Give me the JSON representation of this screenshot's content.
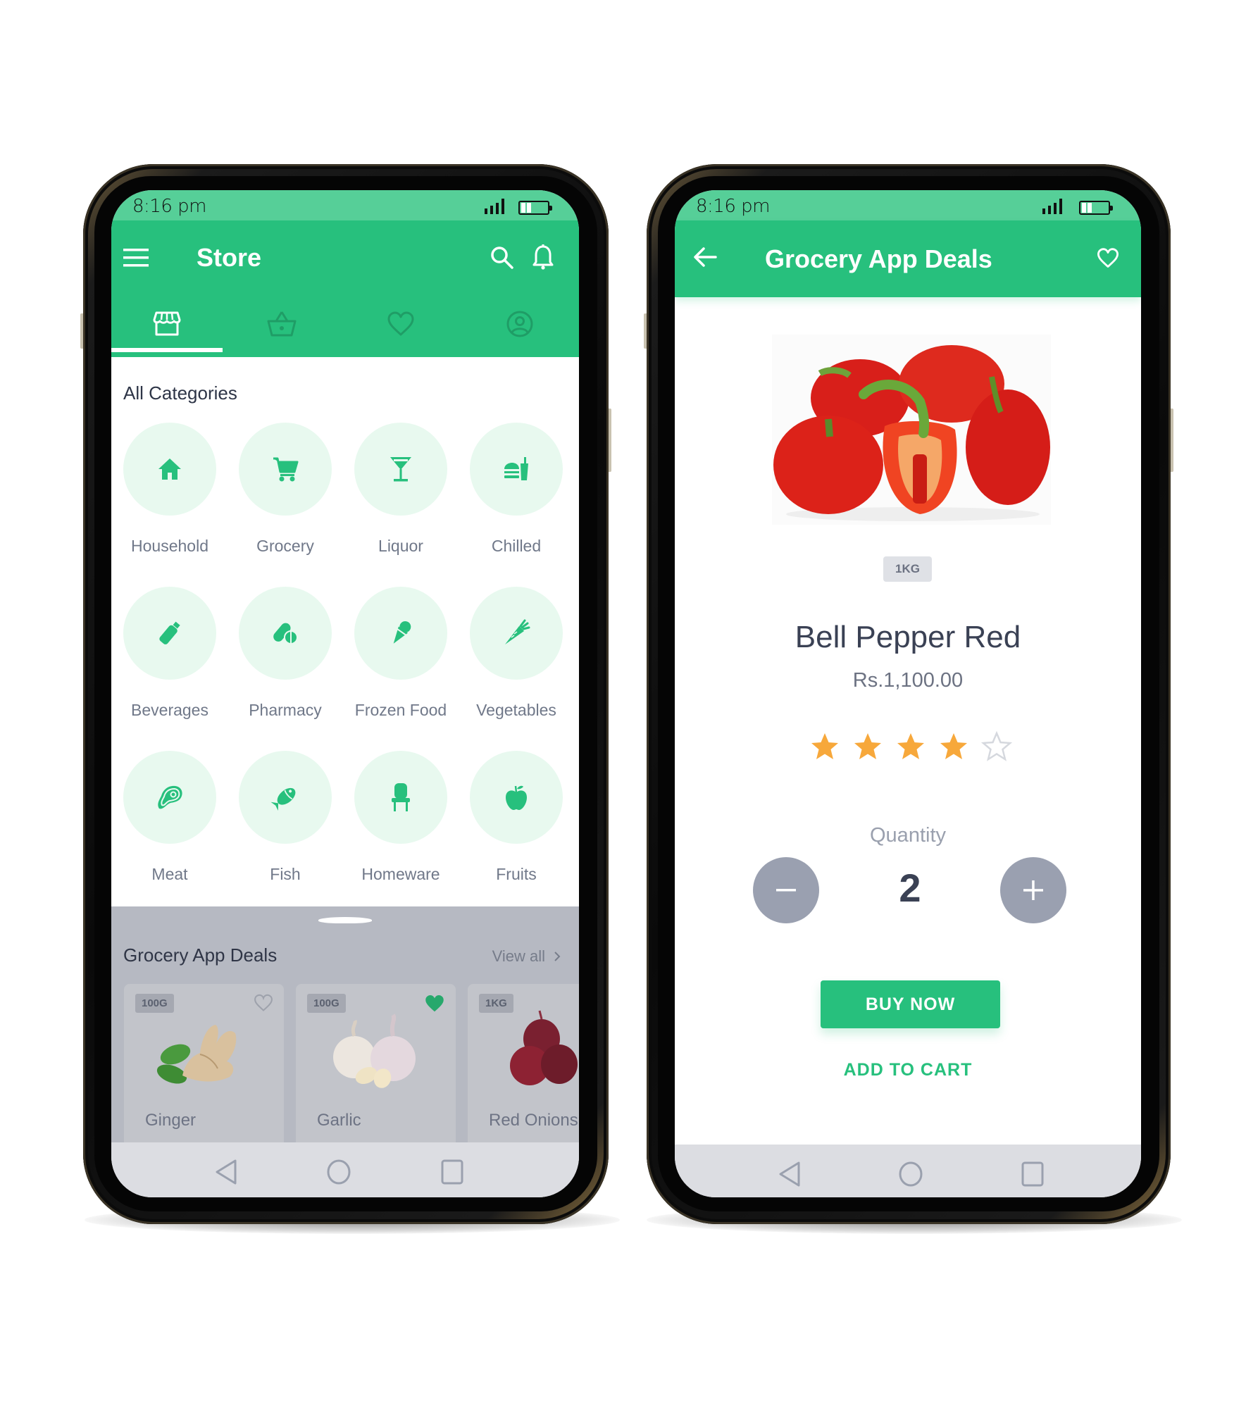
{
  "colors": {
    "brand_green": "#27c07d",
    "status_green": "#56cf98",
    "category_bg": "#e8f9ef",
    "star_filled": "#f7a83b",
    "star_empty": "#d5d8de",
    "qty_button": "#9aa0b0"
  },
  "left_phone": {
    "status_bar": {
      "time": "8:16 pm",
      "signal_icon": "signal-icon",
      "battery_icon": "battery-icon"
    },
    "header": {
      "title": "Store",
      "menu_icon": "hamburger-menu-icon",
      "search_icon": "search-icon",
      "notification_icon": "bell-icon"
    },
    "tabs": [
      {
        "icon": "store-icon",
        "active": true
      },
      {
        "icon": "basket-icon",
        "active": false
      },
      {
        "icon": "heart-icon",
        "active": false
      },
      {
        "icon": "profile-icon",
        "active": false
      }
    ],
    "categories_title": "All Categories",
    "categories": [
      {
        "label": "Household",
        "icon": "house-icon"
      },
      {
        "label": "Grocery",
        "icon": "cart-icon"
      },
      {
        "label": "Liquor",
        "icon": "cocktail-icon"
      },
      {
        "label": "Chilled",
        "icon": "fastfood-icon"
      },
      {
        "label": "Beverages",
        "icon": "bottle-icon"
      },
      {
        "label": "Pharmacy",
        "icon": "pills-icon"
      },
      {
        "label": "Frozen Food",
        "icon": "ice-cream-icon"
      },
      {
        "label": "Vegetables",
        "icon": "carrot-icon"
      },
      {
        "label": "Meat",
        "icon": "steak-icon"
      },
      {
        "label": "Fish",
        "icon": "fish-icon"
      },
      {
        "label": "Homeware",
        "icon": "chair-icon"
      },
      {
        "label": "Fruits",
        "icon": "apple-icon"
      }
    ],
    "deals": {
      "title": "Grocery App Deals",
      "view_all": "View all",
      "items": [
        {
          "name": "Ginger",
          "weight": "100G",
          "favorite": false
        },
        {
          "name": "Garlic",
          "weight": "100G",
          "favorite": true
        },
        {
          "name": "Red Onions",
          "weight": "1KG",
          "favorite": false
        }
      ]
    },
    "nav_bar": [
      "back-icon",
      "home-icon",
      "recents-icon"
    ]
  },
  "right_phone": {
    "status_bar": {
      "time": "8:16 pm"
    },
    "header": {
      "title": "Grocery App Deals",
      "back_icon": "arrow-left-icon",
      "favorite_icon": "heart-outline-icon"
    },
    "product": {
      "image_alt": "Red bell peppers",
      "weight": "1KG",
      "name": "Bell Pepper Red",
      "price": "Rs.1,100.00",
      "rating": 4,
      "rating_max": 5
    },
    "quantity": {
      "label": "Quantity",
      "value": "2",
      "decrement": "−",
      "increment": "+"
    },
    "buy_now": "BUY NOW",
    "add_to_cart": "ADD TO CART",
    "nav_bar": [
      "back-icon",
      "home-icon",
      "recents-icon"
    ]
  }
}
